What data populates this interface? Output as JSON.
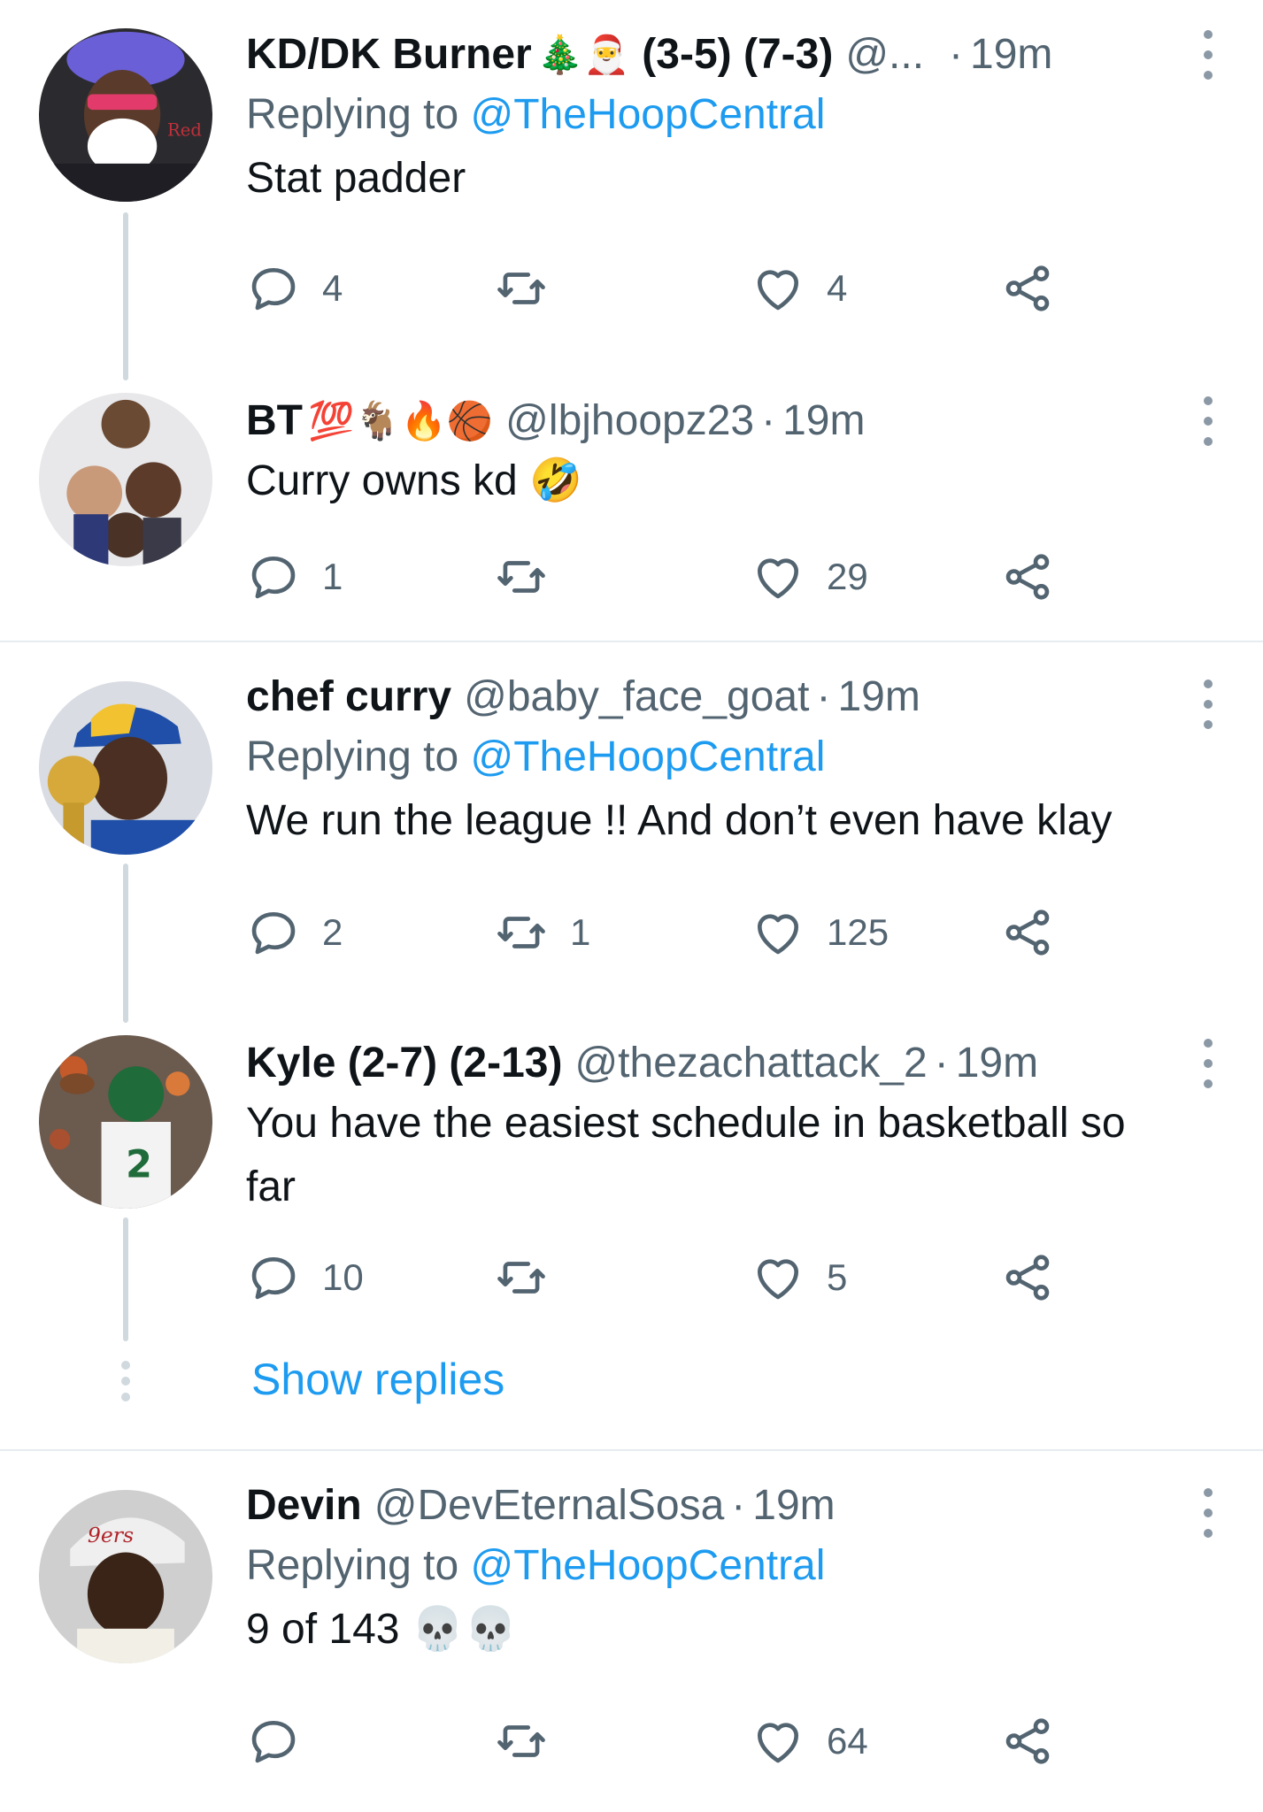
{
  "colors": {
    "accent": "#1d9bf0",
    "secondary_text": "#536471",
    "primary_text": "#0f1419",
    "thread_line": "#cfd9de"
  },
  "show_replies_label": "Show replies",
  "tweets": [
    {
      "display_name": "KD/DK Burner",
      "emojis": "🎄🎅",
      "name_suffix": "(3-5) (7-3)",
      "handle": "@...",
      "separator": "·",
      "time": "19m",
      "replying_prefix": "Replying to",
      "replying_to": "@TheHoopCentral",
      "text": "Stat padder",
      "replies": "4",
      "retweets": "",
      "likes": "4"
    },
    {
      "display_name": "BT",
      "emojis": "💯🐐🔥🏀",
      "name_suffix": "",
      "handle": "@lbjhoopz23",
      "separator": "·",
      "time": "19m",
      "text": "Curry owns kd 🤣",
      "replies": "1",
      "retweets": "",
      "likes": "29"
    },
    {
      "display_name": "chef curry",
      "emojis": "",
      "name_suffix": "",
      "handle": "@baby_face_goat",
      "separator": "·",
      "time": "19m",
      "replying_prefix": "Replying to",
      "replying_to": "@TheHoopCentral",
      "text": "We run the league !! And don’t even have klay",
      "replies": "2",
      "retweets": "1",
      "likes": "125"
    },
    {
      "display_name": "Kyle (2-7) (2-13)",
      "emojis": "",
      "name_suffix": "",
      "handle": "@thezachattack_2",
      "separator": "·",
      "time": "19m",
      "text": "You have the easiest schedule in basketball so far",
      "replies": "10",
      "retweets": "",
      "likes": "5"
    },
    {
      "display_name": "Devin",
      "emojis": "",
      "name_suffix": "",
      "handle": "@DevEternalSosa",
      "separator": "·",
      "time": "19m",
      "replying_prefix": "Replying to",
      "replying_to": "@TheHoopCentral",
      "text": "9 of 143 💀💀",
      "replies": "",
      "retweets": "",
      "likes": "64"
    }
  ]
}
